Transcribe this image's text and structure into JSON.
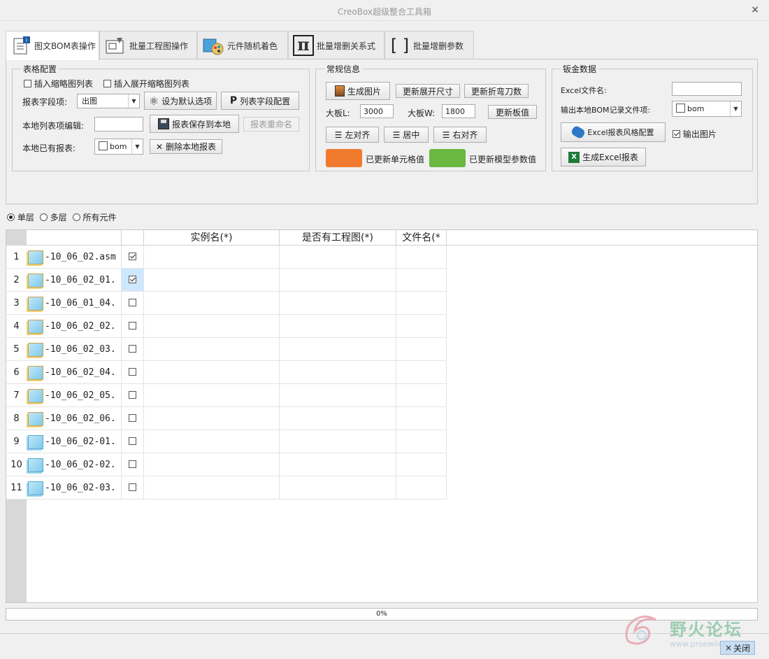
{
  "window": {
    "title": "CreoBox超级整合工具箱",
    "close_glyph": "×"
  },
  "tabs": [
    {
      "label": "图文BOM表操作",
      "icon": "bom-doc-icon"
    },
    {
      "label": "批量工程图操作",
      "icon": "drawing-icon"
    },
    {
      "label": "元件随机着色",
      "icon": "color-palette-icon"
    },
    {
      "label": "批量增删关系式",
      "icon": "pi-icon",
      "glyph": "π"
    },
    {
      "label": "批量增删参数",
      "icon": "brackets-icon",
      "glyph": "[ ]"
    }
  ],
  "table_config": {
    "legend": "表格配置",
    "insert_thumb": "插入缩略图列表",
    "insert_expanded": "插入展开缩略图列表",
    "field_label": "报表字段项:",
    "field_value": "出图",
    "set_default": "设为默认选项",
    "field_config": "列表字段配置",
    "local_edit_label": "本地列表项编辑:",
    "local_edit_value": "",
    "save_local": "报表保存到本地",
    "rename": "报表重命名",
    "existing_label": "本地已有报表:",
    "existing_value": "bom",
    "delete_local": "删除本地报表"
  },
  "general_info": {
    "legend": "常规信息",
    "gen_image": "生成图片",
    "update_unfold": "更新展开尺寸",
    "update_bend": "更新折弯刀数",
    "board_l_label": "大板L:",
    "board_l_value": "3000",
    "board_w_label": "大板W:",
    "board_w_value": "1800",
    "update_board": "更新板值",
    "align_left": "左对齐",
    "align_center": "居中",
    "align_right": "右对齐",
    "legend_orange": "已更新单元格值",
    "legend_green": "已更新模型参数值",
    "orange_color": "#f07b2e",
    "green_color": "#6ab83f"
  },
  "sheetmetal": {
    "legend": "钣金数据",
    "excel_name_label": "Excel文件名:",
    "excel_name_value": "",
    "output_bom_label": "输出本地BOM记录文件项:",
    "output_bom_value": "bom",
    "excel_style": "Excel报表风格配置",
    "output_image": "输出图片",
    "gen_excel": "生成Excel报表"
  },
  "levels": {
    "single": "单层",
    "multi": "多层",
    "all": "所有元件"
  },
  "grid": {
    "columns": [
      "实例名(*)",
      "是否有工程图(*)",
      "文件名(*"
    ],
    "rows": [
      {
        "n": "1",
        "file": "-10_06_02.asm",
        "checked": true
      },
      {
        "n": "2",
        "file": "-10_06_02_01.",
        "checked": true
      },
      {
        "n": "3",
        "file": "-10_06_01_04.",
        "checked": false
      },
      {
        "n": "4",
        "file": "-10_06_02_02.",
        "checked": false
      },
      {
        "n": "5",
        "file": "-10_06_02_03.",
        "checked": false
      },
      {
        "n": "6",
        "file": "-10_06_02_04.",
        "checked": false
      },
      {
        "n": "7",
        "file": "-10_06_02_05.",
        "checked": false
      },
      {
        "n": "8",
        "file": "-10_06_02_06.",
        "checked": false
      },
      {
        "n": "9",
        "file": "-10_06_02-01.",
        "checked": false
      },
      {
        "n": "10",
        "file": "-10_06_02-02.",
        "checked": false
      },
      {
        "n": "11",
        "file": "-10_06_02-03.",
        "checked": false
      }
    ]
  },
  "progress": {
    "text": "0%",
    "value": 0
  },
  "close": {
    "label": "关闭",
    "glyph": "×"
  },
  "watermark": {
    "text": "野火论坛",
    "url": "www.proewildfire.cn"
  }
}
